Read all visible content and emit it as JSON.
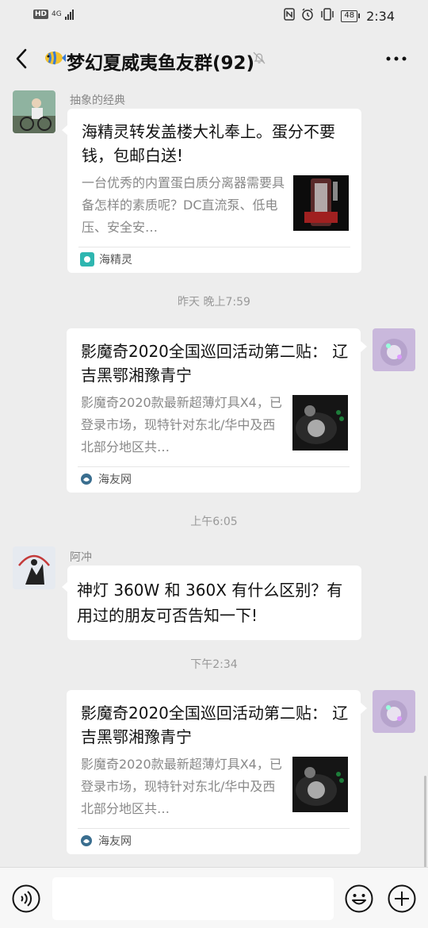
{
  "status_bar": {
    "hd": "HD",
    "network": "4G",
    "battery": "48",
    "time": "2:34"
  },
  "header": {
    "title": "梦幻夏威夷鱼友群(92)",
    "avatar_icon": "tropical-fish-icon"
  },
  "messages": [
    {
      "sender": "抽象的经典",
      "card_title": "海精灵转发盖楼大礼奉上。蛋分不要钱，包邮白送!",
      "card_desc": "一台优秀的内置蛋白质分离器需要具备怎样的素质呢？DC直流泵、低电压、安全安…",
      "source": "海精灵"
    },
    {
      "timestamp": "昨天 晚上7:59",
      "card_title": "影魔奇2020全国巡回活动第二贴： 辽吉黑鄂湘豫青宁",
      "card_desc": "影魔奇2020款最新超薄灯具X4，已登录市场，现特针对东北/华中及西北部分地区共…",
      "source": "海友网"
    },
    {
      "timestamp": "上午6:05",
      "sender": "阿冲",
      "text": "神灯 360W 和 360X 有什么区别？有用过的朋友可否告知一下!"
    },
    {
      "timestamp": "下午2:34",
      "card_title": "影魔奇2020全国巡回活动第二贴： 辽吉黑鄂湘豫青宁",
      "card_desc": "影魔奇2020款最新超薄灯具X4，已登录市场，现特针对东北/华中及西北部分地区共…",
      "source": "海友网"
    }
  ],
  "input_bar": {
    "voice_icon": "voice-icon",
    "emoji_icon": "emoji-icon",
    "plus_icon": "plus-icon"
  }
}
